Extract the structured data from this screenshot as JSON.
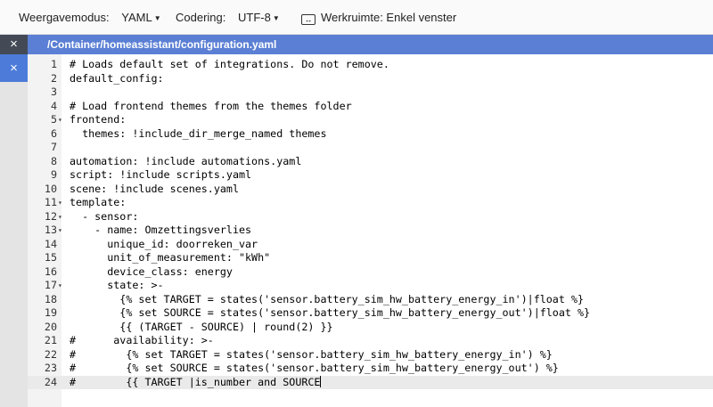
{
  "toolbar": {
    "mode_label": "Weergavemodus:",
    "mode_value": "YAML",
    "encoding_label": "Codering:",
    "encoding_value": "UTF-8",
    "workspace_label": "Werkruimte: Enkel venster"
  },
  "sidebar": {
    "close_symbols": [
      "×",
      "×"
    ]
  },
  "tab": {
    "title": "/Container/homeassistant/configuration.yaml"
  },
  "editor": {
    "active_line": 24,
    "lines": [
      {
        "n": "1",
        "fold": "",
        "text": "# Loads default set of integrations. Do not remove."
      },
      {
        "n": "2",
        "fold": "",
        "text": "default_config:"
      },
      {
        "n": "3",
        "fold": "",
        "text": ""
      },
      {
        "n": "4",
        "fold": "",
        "text": "# Load frontend themes from the themes folder"
      },
      {
        "n": "5",
        "fold": "▾",
        "text": "frontend:"
      },
      {
        "n": "6",
        "fold": "",
        "text": "  themes: !include_dir_merge_named themes"
      },
      {
        "n": "7",
        "fold": "",
        "text": ""
      },
      {
        "n": "8",
        "fold": "",
        "text": "automation: !include automations.yaml"
      },
      {
        "n": "9",
        "fold": "",
        "text": "script: !include scripts.yaml"
      },
      {
        "n": "10",
        "fold": "",
        "text": "scene: !include scenes.yaml"
      },
      {
        "n": "11",
        "fold": "▾",
        "text": "template:"
      },
      {
        "n": "12",
        "fold": "▾",
        "text": "  - sensor:"
      },
      {
        "n": "13",
        "fold": "▾",
        "text": "    - name: Omzettingsverlies"
      },
      {
        "n": "14",
        "fold": "",
        "text": "      unique_id: doorreken_var"
      },
      {
        "n": "15",
        "fold": "",
        "text": "      unit_of_measurement: \"kWh\""
      },
      {
        "n": "16",
        "fold": "",
        "text": "      device_class: energy"
      },
      {
        "n": "17",
        "fold": "▾",
        "text": "      state: >-"
      },
      {
        "n": "18",
        "fold": "",
        "text": "        {% set TARGET = states('sensor.battery_sim_hw_battery_energy_in')|float %}"
      },
      {
        "n": "19",
        "fold": "",
        "text": "        {% set SOURCE = states('sensor.battery_sim_hw_battery_energy_out')|float %}"
      },
      {
        "n": "20",
        "fold": "",
        "text": "        {{ (TARGET - SOURCE) | round(2) }}"
      },
      {
        "n": "21",
        "fold": "",
        "text": "#      availability: >-"
      },
      {
        "n": "22",
        "fold": "",
        "text": "#        {% set TARGET = states('sensor.battery_sim_hw_battery_energy_in') %}"
      },
      {
        "n": "23",
        "fold": "",
        "text": "#        {% set SOURCE = states('sensor.battery_sim_hw_battery_energy_out') %}"
      },
      {
        "n": "24",
        "fold": "",
        "text": "#        {{ TARGET |is_number and SOURCE"
      }
    ]
  }
}
